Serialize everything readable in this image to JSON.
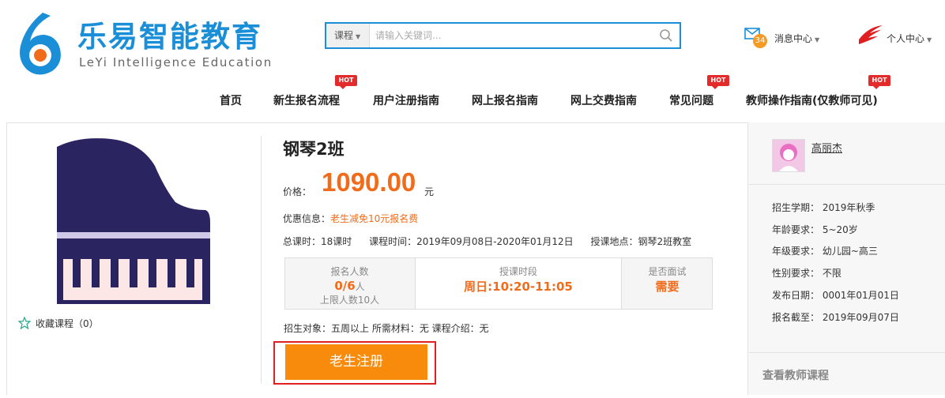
{
  "brand": {
    "name_cn": "乐易智能教育",
    "name_en": "LeYi Intelligence Education"
  },
  "search": {
    "category": "课程",
    "placeholder": "请输入关键词..."
  },
  "messages": {
    "count": "34",
    "label": "消息中心"
  },
  "user": {
    "label": "个人中心"
  },
  "nav": {
    "items": [
      {
        "label": "首页",
        "hot": false
      },
      {
        "label": "新生报名流程",
        "hot": true
      },
      {
        "label": "用户注册指南",
        "hot": false
      },
      {
        "label": "网上报名指南",
        "hot": false
      },
      {
        "label": "网上交费指南",
        "hot": false
      },
      {
        "label": "常见问题",
        "hot": true
      },
      {
        "label": "教师操作指南(仅教师可见)",
        "hot": true
      }
    ],
    "hot_label": "HOT"
  },
  "course": {
    "favorite_label": "收藏课程（0）",
    "title": "钢琴2班",
    "price_label": "价格：",
    "price": "1090.00",
    "price_unit": "元",
    "discount_label": "优惠信息：",
    "discount_value": "老生减免10元报名费",
    "total_hours": "总课时：18课时",
    "schedule": "课程时间：2019年09月08日-2020年01月12日",
    "location": "授课地点：钢琴2班教室",
    "stats": {
      "enrolled_label": "报名人数",
      "enrolled_value": "0/6",
      "enrolled_unit": "人",
      "limit": "上限人数10人",
      "period_label": "授课时段",
      "period_value": "周日:10:20-11:05",
      "interview_label": "是否面试",
      "interview_value": "需要"
    },
    "extra": "招生对象：五周以上  所需材料：无  课程介绍：无",
    "register_button": "老生注册"
  },
  "teacher": {
    "name": "高丽杰",
    "rows": [
      "招生学期：  2019年秋季",
      "年龄要求：  5~20岁",
      "年级要求：  幼儿园~高三",
      "性别要求：  不限",
      "发布日期：  0001年01月01日",
      "报名截至：  2019年09月07日"
    ],
    "view_courses": "查看教师课程"
  },
  "colors": {
    "brand_blue": "#1a8fd8",
    "price_orange": "#f06c1b",
    "button_orange": "#f98b0c",
    "hot_red": "#e32b2b",
    "piano_navy": "#2a2560"
  }
}
